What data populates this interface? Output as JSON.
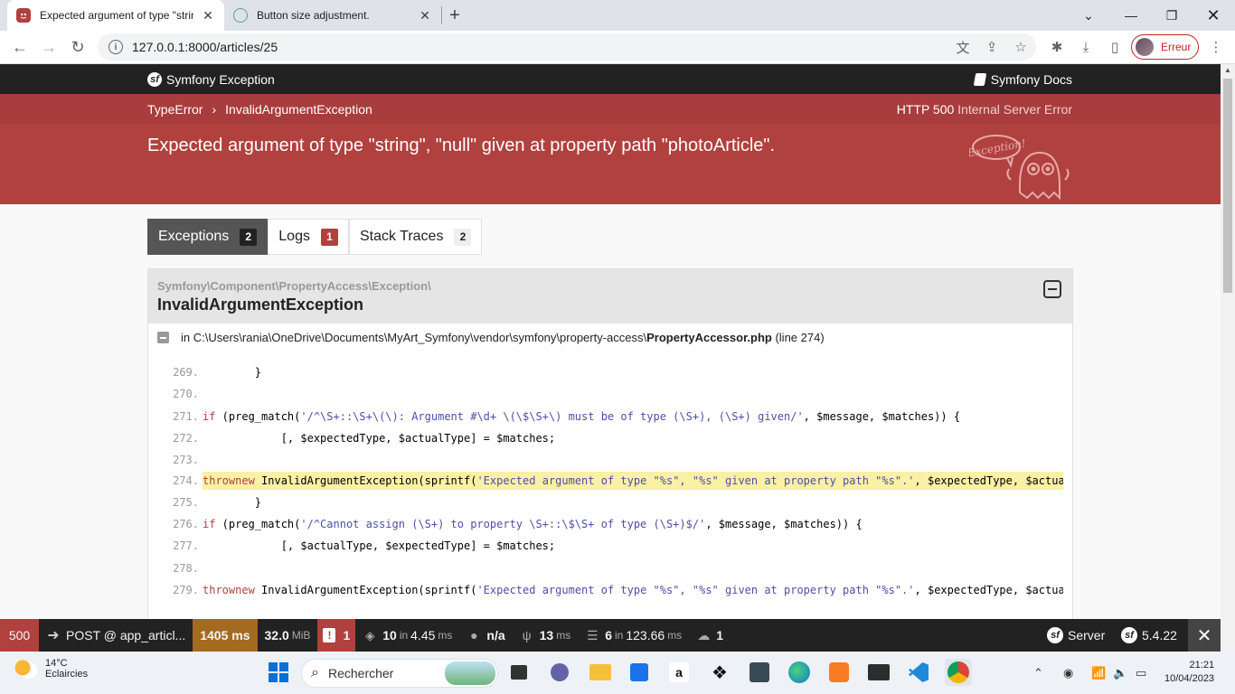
{
  "browser": {
    "tabs": [
      {
        "title": "Expected argument of type \"strin",
        "active": true
      },
      {
        "title": "Button size adjustment.",
        "active": false
      }
    ],
    "url": "127.0.0.1:8000/articles/25",
    "profile_label": "Erreur"
  },
  "symfony": {
    "brand": "Symfony Exception",
    "docs": "Symfony Docs",
    "breadcrumb": {
      "parent": "TypeError",
      "current": "InvalidArgumentException"
    },
    "http_status_code": "HTTP 500",
    "http_status_text": "Internal Server Error",
    "message": "Expected argument of type \"string\", \"null\" given at property path \"photoArticle\".",
    "ghost_text": "Exception!",
    "tabs": [
      {
        "label": "Exceptions",
        "count": "2"
      },
      {
        "label": "Logs",
        "count": "1"
      },
      {
        "label": "Stack Traces",
        "count": "2"
      }
    ],
    "trace": {
      "namespace": "Symfony\\Component\\PropertyAccess\\Exception\\",
      "class": "InvalidArgumentException",
      "file_prefix": "in C:\\Users\\rania\\OneDrive\\Documents\\MyArt_Symfony\\vendor\\symfony\\property-access\\",
      "file_name": "PropertyAccessor.php",
      "file_line": "(line 274)",
      "lines": [
        {
          "num": "269.",
          "code": "        }"
        },
        {
          "num": "270.",
          "code": ""
        },
        {
          "num": "271.",
          "code": "        if (preg_match('/^\\S+::\\S+\\(\\): Argument #\\d+ \\(\\$\\S+\\) must be of type (\\S+), (\\S+) given/', $message, $matches)) {"
        },
        {
          "num": "272.",
          "code": "            [, $expectedType, $actualType] = $matches;"
        },
        {
          "num": "273.",
          "code": ""
        },
        {
          "num": "274.",
          "code": "            throw new InvalidArgumentException(sprintf('Expected argument of type \"%s\", \"%s\" given at property path \"%s\".', $expectedType, $actualType, $propertyPath));"
        },
        {
          "num": "275.",
          "code": "        }"
        },
        {
          "num": "276.",
          "code": "        if (preg_match('/^Cannot assign (\\S+) to property \\S+::\\$\\S+ of type (\\S+)$/', $message, $matches)) {"
        },
        {
          "num": "277.",
          "code": "            [, $actualType, $expectedType] = $matches;"
        },
        {
          "num": "278.",
          "code": ""
        },
        {
          "num": "279.",
          "code": "            throw new InvalidArgumentException(sprintf('Expected argument of type \"%s\", \"%s\" given at property path \"%s\".', $expectedType, $actualType, $propertyPath));"
        }
      ]
    }
  },
  "profiler_toolbar": {
    "status": "500",
    "route": "POST @ app_articl...",
    "time": "1405 ms",
    "memory_value": "32.0",
    "memory_unit": "MiB",
    "errors": "1",
    "forms_count": "10",
    "forms_in": "in",
    "forms_time": "4.45",
    "forms_unit": "ms",
    "user": "n/a",
    "twig_time": "13",
    "twig_unit": "ms",
    "db_count": "6",
    "db_in": "in",
    "db_time": "123.66",
    "db_unit": "ms",
    "cache_count": "1",
    "server_label": "Server",
    "version": "5.4.22"
  },
  "taskbar": {
    "weather_temp": "14°C",
    "weather_desc": "Eclaircies",
    "search_placeholder": "Rechercher",
    "time": "21:21",
    "date": "10/04/2023"
  }
}
